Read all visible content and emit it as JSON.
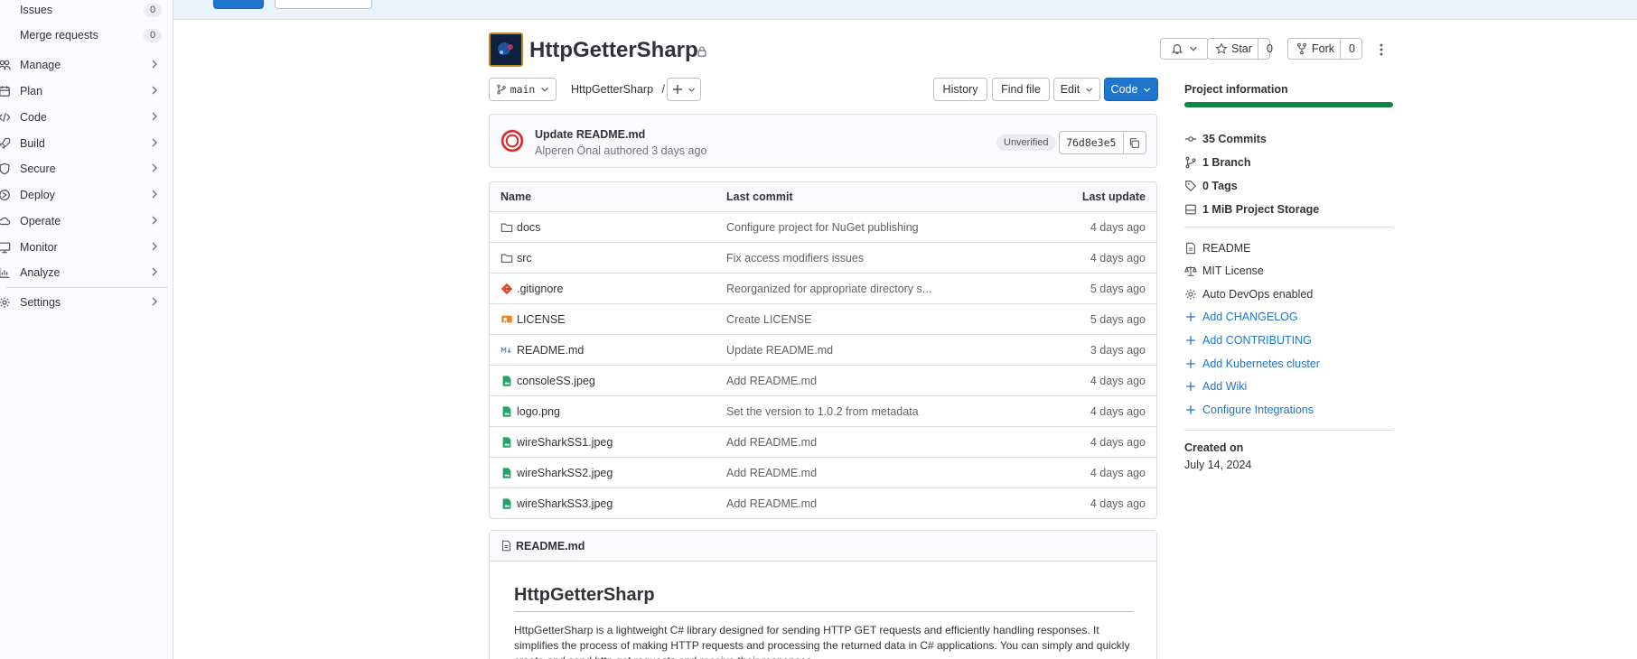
{
  "sidebar": {
    "issues": {
      "label": "Issues",
      "count": "0"
    },
    "merge_requests": {
      "label": "Merge requests",
      "count": "0"
    },
    "items": [
      {
        "label": "Manage",
        "icon": "users-icon"
      },
      {
        "label": "Plan",
        "icon": "calendar-icon"
      },
      {
        "label": "Code",
        "icon": "code-icon"
      },
      {
        "label": "Build",
        "icon": "rocket-icon"
      },
      {
        "label": "Secure",
        "icon": "shield-icon"
      },
      {
        "label": "Deploy",
        "icon": "deploy-icon"
      },
      {
        "label": "Operate",
        "icon": "cloud-icon"
      },
      {
        "label": "Monitor",
        "icon": "monitor-icon"
      },
      {
        "label": "Analyze",
        "icon": "chart-icon"
      },
      {
        "label": "Settings",
        "icon": "gear-icon"
      }
    ]
  },
  "project": {
    "title": "HttpGetterSharp",
    "star_label": "Star",
    "star_count": "0",
    "fork_label": "Fork",
    "fork_count": "0"
  },
  "toolbar": {
    "branch": "main",
    "path": "HttpGetterSharp",
    "path_sep": "/",
    "history": "History",
    "find_file": "Find file",
    "edit": "Edit",
    "code": "Code"
  },
  "commit": {
    "title": "Update README.md",
    "author_line": "Alperen Önal authored 3 days ago",
    "badge": "Unverified",
    "sha": "76d8e3e5"
  },
  "files": {
    "headers": {
      "name": "Name",
      "last_commit": "Last commit",
      "last_update": "Last update"
    },
    "rows": [
      {
        "name": "docs",
        "commit": "Configure project for NuGet publishing",
        "updated": "4 days ago",
        "icon": "folder-icon"
      },
      {
        "name": "src",
        "commit": "Fix access modifiers issues",
        "updated": "4 days ago",
        "icon": "folder-icon"
      },
      {
        "name": ".gitignore",
        "commit": "Reorganized for appropriate directory s...",
        "updated": "5 days ago",
        "icon": "git-icon"
      },
      {
        "name": "LICENSE",
        "commit": "Create LICENSE",
        "updated": "5 days ago",
        "icon": "license-icon"
      },
      {
        "name": "README.md",
        "commit": "Update README.md",
        "updated": "3 days ago",
        "icon": "markdown-icon"
      },
      {
        "name": "consoleSS.jpeg",
        "commit": "Add README.md",
        "updated": "4 days ago",
        "icon": "image-icon"
      },
      {
        "name": "logo.png",
        "commit": "Set the version to 1.0.2 from metadata",
        "updated": "4 days ago",
        "icon": "image-icon"
      },
      {
        "name": "wireSharkSS1.jpeg",
        "commit": "Add README.md",
        "updated": "4 days ago",
        "icon": "image-icon"
      },
      {
        "name": "wireSharkSS2.jpeg",
        "commit": "Add README.md",
        "updated": "4 days ago",
        "icon": "image-icon"
      },
      {
        "name": "wireSharkSS3.jpeg",
        "commit": "Add README.md",
        "updated": "4 days ago",
        "icon": "image-icon"
      }
    ]
  },
  "readme": {
    "file_label": "README.md",
    "heading": "HttpGetterSharp",
    "paragraph": "HttpGetterSharp is a lightweight C# library designed for sending HTTP GET requests and efficiently handling responses. It simplifies the process of making HTTP requests and processing the returned data in C# applications. You can simply and quickly create and send http get requests and receive their responses."
  },
  "project_info": {
    "title": "Project information",
    "stats": [
      {
        "label": "35 Commits",
        "icon": "commit-icon"
      },
      {
        "label": "1 Branch",
        "icon": "branch-icon"
      },
      {
        "label": "0 Tags",
        "icon": "tag-icon"
      },
      {
        "label": "1 MiB Project Storage",
        "icon": "storage-icon"
      }
    ],
    "docs": [
      {
        "label": "README",
        "icon": "doc-icon"
      },
      {
        "label": "MIT License",
        "icon": "scale-icon"
      },
      {
        "label": "Auto DevOps enabled",
        "icon": "gear-icon"
      }
    ],
    "links": [
      {
        "label": "Add CHANGELOG"
      },
      {
        "label": "Add CONTRIBUTING"
      },
      {
        "label": "Add Kubernetes cluster"
      },
      {
        "label": "Add Wiki"
      },
      {
        "label": "Configure Integrations"
      }
    ],
    "created_label": "Created on",
    "created_value": "July 14, 2024"
  },
  "colors": {
    "primary": "#1f75cb",
    "link": "#1f75cb",
    "progress": "#108548",
    "text": "#333238"
  }
}
